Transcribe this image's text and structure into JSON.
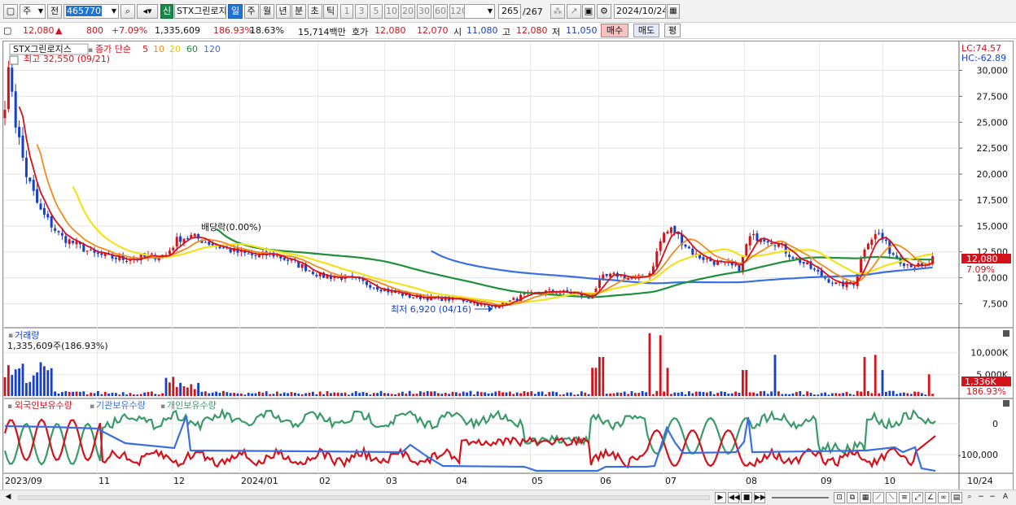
{
  "toolbar": {
    "market_select": "주",
    "prev_label": "전",
    "stock_code": "465770",
    "stock_name": "STX그린로지",
    "sin_label": "신",
    "period_tabs": [
      "일",
      "주",
      "월",
      "년",
      "분",
      "초",
      "틱"
    ],
    "active_tab": "일",
    "interval_buttons": [
      "1",
      "3",
      "5",
      "10",
      "20",
      "30",
      "60",
      "120"
    ],
    "page_current": "265",
    "page_total": "/267",
    "date_value": "2024/10/24"
  },
  "quote": {
    "price": "12,080",
    "change_arrow": "▲",
    "change": "800",
    "change_pct": "+7.09%",
    "volume": "1,335,609",
    "volume_ratio": "186.93%",
    "turnover": "18.63%",
    "amount": "15,714백만",
    "hoga_label": "호가",
    "ask": "12,080",
    "bid": "12,070",
    "open_label": "시",
    "open": "11,080",
    "high_label": "고",
    "high": "12,080",
    "low_label": "저",
    "low": "11,050",
    "buy_button": "매수",
    "sell_button": "매도",
    "eval_button": "평"
  },
  "chart": {
    "legend_stock": "STX그린로지스",
    "legend_ma_label": "종가 단순",
    "legend_ma_periods": [
      "5",
      "10",
      "20",
      "60",
      "120"
    ],
    "high_annotation": "최고 32,550 (09/21)",
    "low_annotation": "최저 6,920 (04/16)",
    "dividend_annotation": "배당락(0.00%)",
    "lc_label": "LC:74.57",
    "hc_label": "HC:-62.89",
    "price_tag": "12,080",
    "pct_tag": "7.09%",
    "volume_title": "거래량",
    "volume_value": "1,335,609주(186.93%)",
    "volume_tag": "1,336K",
    "volume_pct_tag": "186.93%",
    "holdings_legend": [
      "외국인보유수량",
      "기관보유수량",
      "개인보유수량"
    ],
    "x_labels": [
      "2023/09",
      "11",
      "12",
      "2024/01",
      "02",
      "03",
      "04",
      "05",
      "06",
      "07",
      "08",
      "09",
      "10",
      "10/24"
    ],
    "colors": {
      "up": "#d3121b",
      "down": "#1640c9",
      "ma5": "#d3121b",
      "ma10": "#f08a1c",
      "ma20": "#f2e21c",
      "ma60": "#1e8f3a",
      "ma120": "#3b6fe0",
      "foreign": "#d3121b",
      "inst": "#3b6fe0",
      "retail": "#3a9a6a"
    }
  },
  "chart_data": [
    {
      "type": "line",
      "title": "STX그린로지스 일봉",
      "y_ticks": [
        "30,000",
        "27,500",
        "25,000",
        "22,500",
        "20,000",
        "17,500",
        "15,000",
        "12,500",
        "10,000",
        "7,500"
      ],
      "ylim": [
        5500,
        32550
      ],
      "x": [
        "2023/09",
        "11",
        "12",
        "2024/01",
        "02",
        "03",
        "04",
        "05",
        "06",
        "07",
        "08",
        "09",
        "10",
        "10/24"
      ],
      "close_approx": [
        27000,
        13500,
        12500,
        12000,
        11500,
        10000,
        8200,
        7300,
        8800,
        15000,
        12000,
        13000,
        9500,
        15000,
        10800,
        12080
      ],
      "last_close": 12080,
      "high": 32550,
      "low": 6920
    },
    {
      "type": "bar",
      "title": "거래량",
      "y_ticks": [
        "10,000K",
        "5,000K"
      ],
      "last_value_k": 1336
    },
    {
      "type": "line",
      "title": "보유수량",
      "series": [
        {
          "name": "외국인보유수량"
        },
        {
          "name": "기관보유수량"
        },
        {
          "name": "개인보유수량"
        }
      ],
      "y_ticks": [
        "0",
        "-100,000"
      ]
    }
  ]
}
